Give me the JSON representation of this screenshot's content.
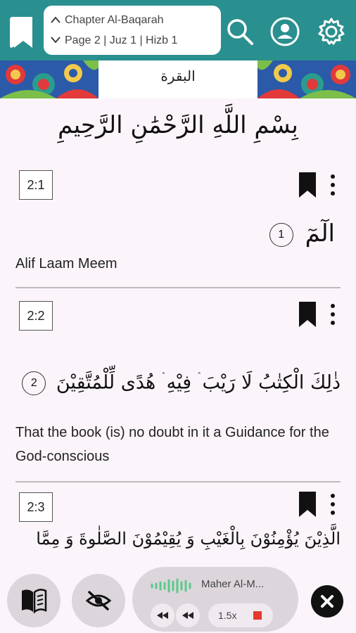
{
  "header": {
    "chapter_label": "Chapter Al-Baqarah",
    "page_label": "Page 2 | Juz 1 | Hizb 1"
  },
  "banner": {
    "surah_name_arabic": "البقرة"
  },
  "bismillah": "بِسْمِ اللَّهِ الرَّحْمَٰنِ الرَّحِيمِ",
  "verses": [
    {
      "ref": "2:1",
      "arabic": "الٓمٓ",
      "number": "1",
      "translation": "Alif Laam Meem"
    },
    {
      "ref": "2:2",
      "arabic": "ذٰلِكَ الْكِتٰبُ لَا رَيْبَ ۛ فِيْهِ ۛ هُدًى لِّلْمُتَّقِيْنَ",
      "number": "2",
      "translation": "That the book (is) no doubt in it a Guidance for the God-conscious"
    },
    {
      "ref": "2:3",
      "arabic": "الَّذِيْنَ يُؤْمِنُوْنَ بِالْغَيْبِ وَ يُقِيْمُوْنَ الصَّلٰوةَ وَ مِمَّا",
      "number": "",
      "translation": ""
    }
  ],
  "player": {
    "reciter": "Maher Al-M...",
    "speed": "1.5x"
  },
  "colors": {
    "header_bg": "#2a8f8f",
    "page_bg": "#fbf5fb",
    "control_bg": "#dcd6dc",
    "waveform": "#5cc98a",
    "stop": "#e43a2b"
  },
  "icons": {
    "header": [
      "book-icon",
      "chevron-up-icon",
      "chevron-down-icon",
      "search-icon",
      "user-icon",
      "gear-icon"
    ],
    "verse": [
      "bookmark-icon",
      "more-vertical-icon"
    ],
    "bottom": [
      "reading-mode-icon",
      "hide-icon",
      "waveform-icon",
      "rewind-icon",
      "stop-icon",
      "close-icon"
    ]
  }
}
